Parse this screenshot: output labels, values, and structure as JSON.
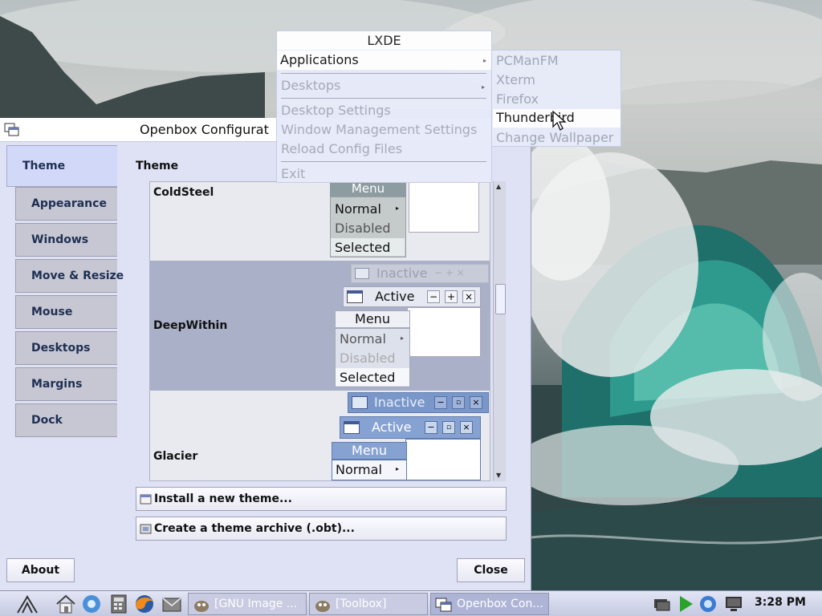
{
  "lxde_menu": {
    "title": "LXDE",
    "items": [
      {
        "label": "Applications",
        "highlighted": true,
        "submenu": true
      },
      {
        "label": "Desktops",
        "submenu": true
      },
      {
        "label": "Desktop Settings"
      },
      {
        "label": "Window Management Settings"
      },
      {
        "label": "Reload Config Files"
      },
      {
        "label": "Exit"
      }
    ]
  },
  "apps_submenu": {
    "items": [
      {
        "label": "PCManFM"
      },
      {
        "label": "Xterm"
      },
      {
        "label": "Firefox"
      },
      {
        "label": "Thunderbird",
        "highlighted": true
      },
      {
        "label": "Change Wallpaper"
      }
    ]
  },
  "obconf": {
    "title": "Openbox Configurat",
    "tabs": [
      "Theme",
      "Appearance",
      "Windows",
      "Move & Resize",
      "Mouse",
      "Desktops",
      "Margins",
      "Dock"
    ],
    "active_tab": "Theme",
    "section_title": "Theme",
    "themes": [
      {
        "name": "ColdSteel",
        "preview": {
          "menu_title": "Menu",
          "menu_items": [
            "Normal",
            "Disabled",
            "Selected"
          ]
        }
      },
      {
        "name": "DeepWithin",
        "selected": true,
        "preview": {
          "inactive": "Inactive",
          "active": "Active",
          "menu_title": "Menu",
          "menu_items": [
            "Normal",
            "Disabled",
            "Selected"
          ]
        }
      },
      {
        "name": "Glacier",
        "preview": {
          "inactive": "Inactive",
          "active": "Active",
          "menu_title": "Menu",
          "menu_items": [
            "Normal"
          ]
        }
      }
    ],
    "install_button": "Install a new theme...",
    "archive_button": "Create a theme archive (.obt)...",
    "about_button": "About",
    "close_button": "Close"
  },
  "panel": {
    "tasks": [
      {
        "label": "[GNU Image ..."
      },
      {
        "label": "[Toolbox]"
      },
      {
        "label": "Openbox Con..."
      }
    ],
    "active_task": "Openbox Con...",
    "clock": "3:28 PM"
  },
  "colors": {
    "window_bg": "#dfe1f5",
    "selection_row": "#a9b0c8",
    "glacier_blue": "#7a97c9",
    "panel_accent": "#aeb4d6"
  }
}
